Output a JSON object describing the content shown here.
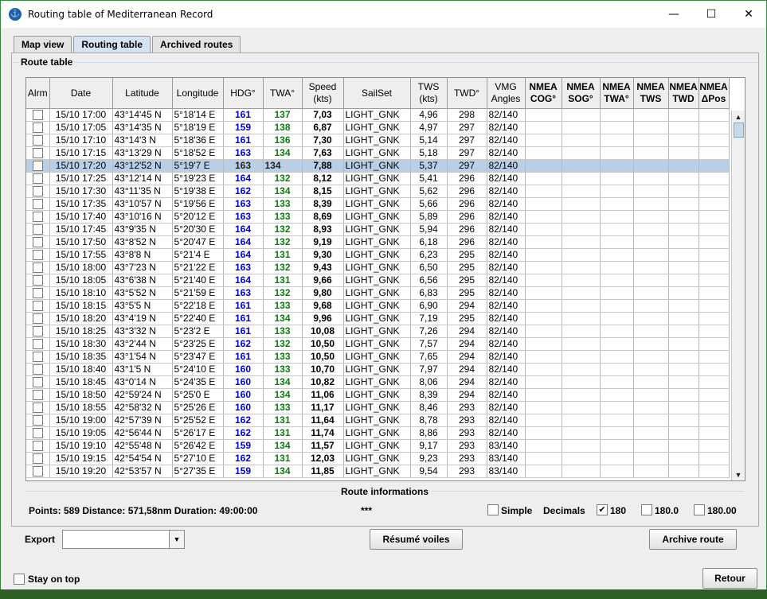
{
  "window": {
    "title": "Routing table of Mediterranean Record",
    "minimize": "—",
    "maximize": "☐",
    "close": "✕"
  },
  "tabs": [
    "Map view",
    "Routing table",
    "Archived routes"
  ],
  "panel_title": "Route table",
  "headers": [
    {
      "l1": "Alrm",
      "l2": ""
    },
    {
      "l1": "Date",
      "l2": ""
    },
    {
      "l1": "Latitude",
      "l2": ""
    },
    {
      "l1": "Longitude",
      "l2": ""
    },
    {
      "l1": "HDG°",
      "l2": ""
    },
    {
      "l1": "TWA°",
      "l2": ""
    },
    {
      "l1": "Speed",
      "l2": "(kts)"
    },
    {
      "l1": "SailSet",
      "l2": ""
    },
    {
      "l1": "TWS",
      "l2": "(kts)"
    },
    {
      "l1": "TWD°",
      "l2": ""
    },
    {
      "l1": "VMG",
      "l2": "Angles"
    },
    {
      "l1": "NMEA",
      "l2": "COG°"
    },
    {
      "l1": "NMEA",
      "l2": "SOG°"
    },
    {
      "l1": "NMEA",
      "l2": "TWA°"
    },
    {
      "l1": "NMEA",
      "l2": "TWS"
    },
    {
      "l1": "NMEA",
      "l2": "TWD"
    },
    {
      "l1": "NMEA",
      "l2": "ΔPos"
    }
  ],
  "rows": [
    {
      "date": "15/10 17:00",
      "lat": "43°14'45 N",
      "lon": "5°18'14 E",
      "hdg": "161",
      "twa": "137",
      "speed": "7,03",
      "sail": "LIGHT_GNK",
      "tws": "4,96",
      "twd": "298",
      "vmg": "82/140"
    },
    {
      "date": "15/10 17:05",
      "lat": "43°14'35 N",
      "lon": "5°18'19 E",
      "hdg": "159",
      "twa": "138",
      "speed": "6,87",
      "sail": "LIGHT_GNK",
      "tws": "4,97",
      "twd": "297",
      "vmg": "82/140"
    },
    {
      "date": "15/10 17:10",
      "lat": "43°14'3 N",
      "lon": "5°18'36 E",
      "hdg": "161",
      "twa": "136",
      "speed": "7,30",
      "sail": "LIGHT_GNK",
      "tws": "5,14",
      "twd": "297",
      "vmg": "82/140"
    },
    {
      "date": "15/10 17:15",
      "lat": "43°13'29 N",
      "lon": "5°18'52 E",
      "hdg": "163",
      "twa": "134",
      "speed": "7,63",
      "sail": "LIGHT_GNK",
      "tws": "5,18",
      "twd": "297",
      "vmg": "82/140"
    },
    {
      "date": "15/10 17:20",
      "lat": "43°12'52 N",
      "lon": "5°19'7 E",
      "hdg": "163",
      "twa": "134",
      "speed": "7,88",
      "sail": "LIGHT_GNK",
      "tws": "5,37",
      "twd": "297",
      "vmg": "82/140",
      "selected": true
    },
    {
      "date": "15/10 17:25",
      "lat": "43°12'14 N",
      "lon": "5°19'23 E",
      "hdg": "164",
      "twa": "132",
      "speed": "8,12",
      "sail": "LIGHT_GNK",
      "tws": "5,41",
      "twd": "296",
      "vmg": "82/140"
    },
    {
      "date": "15/10 17:30",
      "lat": "43°11'35 N",
      "lon": "5°19'38 E",
      "hdg": "162",
      "twa": "134",
      "speed": "8,15",
      "sail": "LIGHT_GNK",
      "tws": "5,62",
      "twd": "296",
      "vmg": "82/140"
    },
    {
      "date": "15/10 17:35",
      "lat": "43°10'57 N",
      "lon": "5°19'56 E",
      "hdg": "163",
      "twa": "133",
      "speed": "8,39",
      "sail": "LIGHT_GNK",
      "tws": "5,66",
      "twd": "296",
      "vmg": "82/140"
    },
    {
      "date": "15/10 17:40",
      "lat": "43°10'16 N",
      "lon": "5°20'12 E",
      "hdg": "163",
      "twa": "133",
      "speed": "8,69",
      "sail": "LIGHT_GNK",
      "tws": "5,89",
      "twd": "296",
      "vmg": "82/140"
    },
    {
      "date": "15/10 17:45",
      "lat": "43°9'35 N",
      "lon": "5°20'30 E",
      "hdg": "164",
      "twa": "132",
      "speed": "8,93",
      "sail": "LIGHT_GNK",
      "tws": "5,94",
      "twd": "296",
      "vmg": "82/140"
    },
    {
      "date": "15/10 17:50",
      "lat": "43°8'52 N",
      "lon": "5°20'47 E",
      "hdg": "164",
      "twa": "132",
      "speed": "9,19",
      "sail": "LIGHT_GNK",
      "tws": "6,18",
      "twd": "296",
      "vmg": "82/140"
    },
    {
      "date": "15/10 17:55",
      "lat": "43°8'8 N",
      "lon": "5°21'4 E",
      "hdg": "164",
      "twa": "131",
      "speed": "9,30",
      "sail": "LIGHT_GNK",
      "tws": "6,23",
      "twd": "295",
      "vmg": "82/140"
    },
    {
      "date": "15/10 18:00",
      "lat": "43°7'23 N",
      "lon": "5°21'22 E",
      "hdg": "163",
      "twa": "132",
      "speed": "9,43",
      "sail": "LIGHT_GNK",
      "tws": "6,50",
      "twd": "295",
      "vmg": "82/140"
    },
    {
      "date": "15/10 18:05",
      "lat": "43°6'38 N",
      "lon": "5°21'40 E",
      "hdg": "164",
      "twa": "131",
      "speed": "9,66",
      "sail": "LIGHT_GNK",
      "tws": "6,56",
      "twd": "295",
      "vmg": "82/140"
    },
    {
      "date": "15/10 18:10",
      "lat": "43°5'52 N",
      "lon": "5°21'59 E",
      "hdg": "163",
      "twa": "132",
      "speed": "9,80",
      "sail": "LIGHT_GNK",
      "tws": "6,83",
      "twd": "295",
      "vmg": "82/140"
    },
    {
      "date": "15/10 18:15",
      "lat": "43°5'5 N",
      "lon": "5°22'18 E",
      "hdg": "161",
      "twa": "133",
      "speed": "9,68",
      "sail": "LIGHT_GNK",
      "tws": "6,90",
      "twd": "294",
      "vmg": "82/140"
    },
    {
      "date": "15/10 18:20",
      "lat": "43°4'19 N",
      "lon": "5°22'40 E",
      "hdg": "161",
      "twa": "134",
      "speed": "9,96",
      "sail": "LIGHT_GNK",
      "tws": "7,19",
      "twd": "295",
      "vmg": "82/140"
    },
    {
      "date": "15/10 18:25",
      "lat": "43°3'32 N",
      "lon": "5°23'2 E",
      "hdg": "161",
      "twa": "133",
      "speed": "10,08",
      "sail": "LIGHT_GNK",
      "tws": "7,26",
      "twd": "294",
      "vmg": "82/140"
    },
    {
      "date": "15/10 18:30",
      "lat": "43°2'44 N",
      "lon": "5°23'25 E",
      "hdg": "162",
      "twa": "132",
      "speed": "10,50",
      "sail": "LIGHT_GNK",
      "tws": "7,57",
      "twd": "294",
      "vmg": "82/140"
    },
    {
      "date": "15/10 18:35",
      "lat": "43°1'54 N",
      "lon": "5°23'47 E",
      "hdg": "161",
      "twa": "133",
      "speed": "10,50",
      "sail": "LIGHT_GNK",
      "tws": "7,65",
      "twd": "294",
      "vmg": "82/140"
    },
    {
      "date": "15/10 18:40",
      "lat": "43°1'5 N",
      "lon": "5°24'10 E",
      "hdg": "160",
      "twa": "133",
      "speed": "10,70",
      "sail": "LIGHT_GNK",
      "tws": "7,97",
      "twd": "294",
      "vmg": "82/140"
    },
    {
      "date": "15/10 18:45",
      "lat": "43°0'14 N",
      "lon": "5°24'35 E",
      "hdg": "160",
      "twa": "134",
      "speed": "10,82",
      "sail": "LIGHT_GNK",
      "tws": "8,06",
      "twd": "294",
      "vmg": "82/140"
    },
    {
      "date": "15/10 18:50",
      "lat": "42°59'24 N",
      "lon": "5°25'0 E",
      "hdg": "160",
      "twa": "134",
      "speed": "11,06",
      "sail": "LIGHT_GNK",
      "tws": "8,39",
      "twd": "294",
      "vmg": "82/140"
    },
    {
      "date": "15/10 18:55",
      "lat": "42°58'32 N",
      "lon": "5°25'26 E",
      "hdg": "160",
      "twa": "133",
      "speed": "11,17",
      "sail": "LIGHT_GNK",
      "tws": "8,46",
      "twd": "293",
      "vmg": "82/140"
    },
    {
      "date": "15/10 19:00",
      "lat": "42°57'39 N",
      "lon": "5°25'52 E",
      "hdg": "162",
      "twa": "131",
      "speed": "11,64",
      "sail": "LIGHT_GNK",
      "tws": "8,78",
      "twd": "293",
      "vmg": "82/140"
    },
    {
      "date": "15/10 19:05",
      "lat": "42°56'44 N",
      "lon": "5°26'17 E",
      "hdg": "162",
      "twa": "131",
      "speed": "11,74",
      "sail": "LIGHT_GNK",
      "tws": "8,86",
      "twd": "293",
      "vmg": "82/140"
    },
    {
      "date": "15/10 19:10",
      "lat": "42°55'48 N",
      "lon": "5°26'42 E",
      "hdg": "159",
      "twa": "134",
      "speed": "11,57",
      "sail": "LIGHT_GNK",
      "tws": "9,17",
      "twd": "293",
      "vmg": "83/140"
    },
    {
      "date": "15/10 19:15",
      "lat": "42°54'54 N",
      "lon": "5°27'10 E",
      "hdg": "162",
      "twa": "131",
      "speed": "12,03",
      "sail": "LIGHT_GNK",
      "tws": "9,23",
      "twd": "293",
      "vmg": "83/140"
    },
    {
      "date": "15/10 19:20",
      "lat": "42°53'57 N",
      "lon": "5°27'35 E",
      "hdg": "159",
      "twa": "134",
      "speed": "11,85",
      "sail": "LIGHT_GNK",
      "tws": "9,54",
      "twd": "293",
      "vmg": "83/140"
    }
  ],
  "info": {
    "title": "Route informations",
    "summary": "Points: 589 Distance: 571,58nm Duration: 49:00:00",
    "stars": "***",
    "simple_label": "Simple",
    "decimals_label": "Decimals",
    "opt_180": "180",
    "opt_1800": "180.0",
    "opt_18000": "180.00",
    "check_mark": "✔"
  },
  "export_label": "Export",
  "export_value": "",
  "buttons": {
    "resume": "Résumé voiles",
    "archive": "Archive route",
    "retour": "Retour"
  },
  "stay_on_top": "Stay on top",
  "colors": {
    "hdg": "#0000d8",
    "twa": "#107a10",
    "selected_row": "#b8cfe5"
  }
}
